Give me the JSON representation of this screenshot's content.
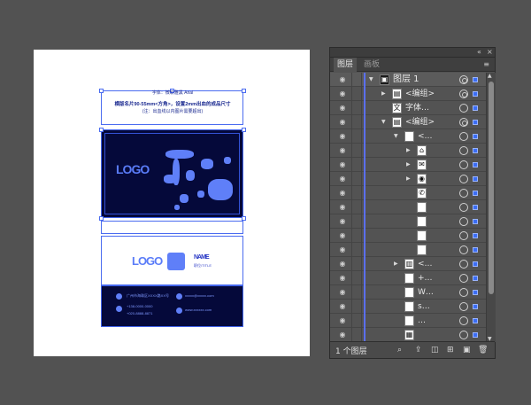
{
  "artboard": {
    "header_line1": "字体：微软雅黑 Arial",
    "header_line2": "横版名片90-55mm<方角>，设置2mm出血的成品尺寸",
    "header_line3": "(注：出血线以内图片需要超出)",
    "logo_text": "LOGO",
    "name_text": "NAME",
    "name_sub": "职位/TITLE",
    "contact_address": "广州市海珠区XXXX路XX号",
    "contact_email": "xxxxx@xxxxx.com",
    "contact_phone1": "+138-0000-0000",
    "contact_phone2": "+020-8888-8871",
    "contact_web": "www.xxxxxx.com"
  },
  "panel": {
    "collapse_icon": "double-chevron",
    "close_icon": "close",
    "tabs": [
      {
        "label": "图层",
        "active": true
      },
      {
        "label": "画板",
        "active": false
      }
    ],
    "menu_icon": "panel-menu",
    "layers": [
      {
        "label": "图层 1",
        "twisty": "▼",
        "thumb": "▣",
        "depth": 0,
        "kind": "layer",
        "target": "on"
      },
      {
        "label": "<编组>",
        "twisty": "▶",
        "thumb": "▤",
        "depth": 1,
        "kind": "group",
        "target": "on"
      },
      {
        "label": "字体…",
        "twisty": "",
        "thumb": "文",
        "depth": 1,
        "kind": "item",
        "target": "off"
      },
      {
        "label": "<编组>",
        "twisty": "▼",
        "thumb": "▤",
        "depth": 1,
        "kind": "group",
        "target": "on"
      },
      {
        "label": "<…",
        "twisty": "▼",
        "thumb": "",
        "depth": 2,
        "kind": "group",
        "target": "off"
      },
      {
        "label": "",
        "twisty": "▶",
        "thumb": "⌂",
        "depth": 3,
        "kind": "group",
        "target": "off"
      },
      {
        "label": "",
        "twisty": "▶",
        "thumb": "✉",
        "depth": 3,
        "kind": "group",
        "target": "off"
      },
      {
        "label": "",
        "twisty": "▶",
        "thumb": "◉",
        "depth": 3,
        "kind": "group",
        "target": "off"
      },
      {
        "label": "",
        "twisty": "",
        "thumb": "✆",
        "depth": 3,
        "kind": "item",
        "target": "off"
      },
      {
        "label": "",
        "twisty": "",
        "thumb": "",
        "depth": 3,
        "kind": "item",
        "target": "off"
      },
      {
        "label": "",
        "twisty": "",
        "thumb": "",
        "depth": 3,
        "kind": "item",
        "target": "off"
      },
      {
        "label": "",
        "twisty": "",
        "thumb": "",
        "depth": 3,
        "kind": "item",
        "target": "off"
      },
      {
        "label": "",
        "twisty": "",
        "thumb": "",
        "depth": 3,
        "kind": "item",
        "target": "off"
      },
      {
        "label": "<…",
        "twisty": "▶",
        "thumb": "▥",
        "depth": 2,
        "kind": "group",
        "target": "off"
      },
      {
        "label": "+…",
        "twisty": "",
        "thumb": "",
        "depth": 2,
        "kind": "item",
        "target": "off"
      },
      {
        "label": "W…",
        "twisty": "",
        "thumb": "",
        "depth": 2,
        "kind": "item",
        "target": "off"
      },
      {
        "label": "s…",
        "twisty": "",
        "thumb": "",
        "depth": 2,
        "kind": "item",
        "target": "off"
      },
      {
        "label": "…",
        "twisty": "",
        "thumb": "",
        "depth": 2,
        "kind": "item",
        "target": "off"
      },
      {
        "label": "",
        "twisty": "",
        "thumb": "▦",
        "depth": 2,
        "kind": "item",
        "target": "off"
      }
    ],
    "footer": {
      "count_label": "1 个图层",
      "buttons": [
        "search",
        "export",
        "clip-mask",
        "new-sublayer",
        "new-layer",
        "delete"
      ]
    }
  },
  "colors": {
    "canvas_bg": "#525252",
    "card_dark": "#05093a",
    "selection_blue": "#4b6cf0",
    "layer_color": "#5a6ff0"
  }
}
